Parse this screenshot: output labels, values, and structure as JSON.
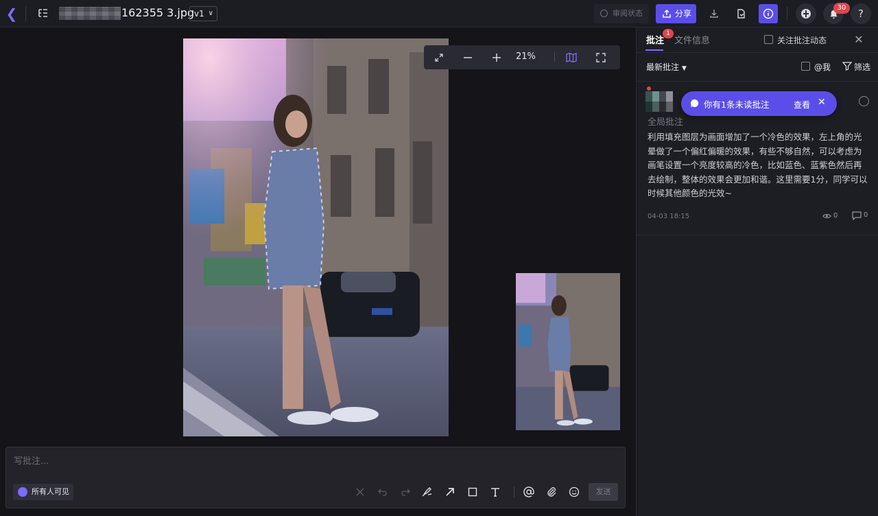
{
  "header": {
    "filename": "162355 3.jpg",
    "version": "v1",
    "review_status": "审阅状态",
    "share": "分享",
    "notification_count": "30",
    "help": "?"
  },
  "viewer": {
    "zoom": "21%"
  },
  "composer": {
    "placeholder": "写批注...",
    "visibility": "所有人可见",
    "send": "发送"
  },
  "panel": {
    "tabs": {
      "notes": "批注",
      "notes_badge": "1",
      "file_info": "文件信息"
    },
    "follow_label": "关注批注动态",
    "sort_label": "最新批注",
    "mine_label": "@我",
    "filter_label": "筛选",
    "toast": {
      "message": "你有1条未读批注",
      "action": "查看"
    },
    "comment": {
      "scope": "全局批注",
      "body": "利用填充图层为画面增加了一个冷色的效果，左上角的光晕做了一个偏红偏暖的效果，有些不够自然，可以考虑为画笔设置一个亮度较高的冷色，比如蓝色、蓝紫色然后再去绘制，整体的效果会更加和谐。这里需要1分，同学可以时候其他颜色的光效~",
      "time": "04-03 18:15",
      "views": "0",
      "replies": "0"
    }
  },
  "colors": {
    "accent": "#5b4ee8",
    "badge": "#e0454b",
    "background": "#141419",
    "panel": "#1d1d24"
  }
}
